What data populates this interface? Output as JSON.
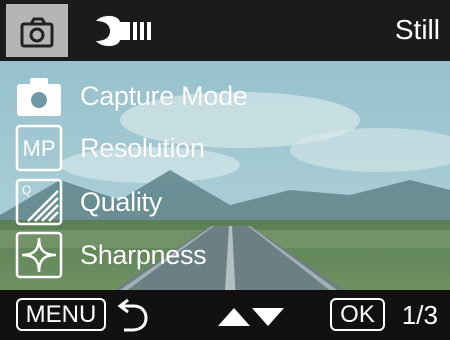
{
  "topbar": {
    "camera_tab_icon": "camera-icon",
    "tools_tab_icon": "wrench-icon",
    "mode_label": "Still"
  },
  "menu": {
    "items": [
      {
        "label": "Capture Mode",
        "icon": "camera-icon"
      },
      {
        "label": "Resolution",
        "icon": "megapixel-icon",
        "icon_text": "MP"
      },
      {
        "label": "Quality",
        "icon": "quality-icon",
        "icon_text": "Q"
      },
      {
        "label": "Sharpness",
        "icon": "sharpness-icon"
      }
    ]
  },
  "bottombar": {
    "menu_label": "MENU",
    "back_icon": "back-arrow-icon",
    "updown_icon": "up-down-arrows-icon",
    "ok_label": "OK",
    "page_indicator": "1/3"
  },
  "colors": {
    "topbar_bg": "#1b1b1b",
    "camera_tab_bg": "#b5b5b5",
    "bottombar_bg": "#111111",
    "text": "#ffffff"
  }
}
